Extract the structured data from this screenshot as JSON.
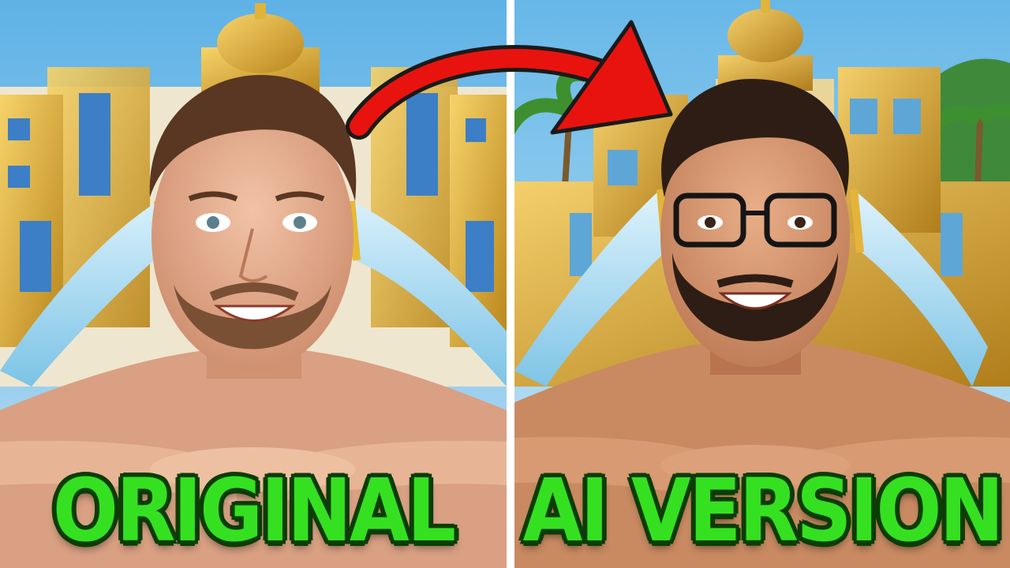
{
  "captions": {
    "left": "ORIGINAL",
    "right": "AI VERSION"
  },
  "colors": {
    "caption_fill": "#35e021",
    "caption_outline": "#0b3d05",
    "arrow": "#e8130f",
    "sky": "#7fc3ea",
    "gold": "#d9a92a",
    "water": "#a9daf0",
    "skin": "#e0a88a"
  }
}
